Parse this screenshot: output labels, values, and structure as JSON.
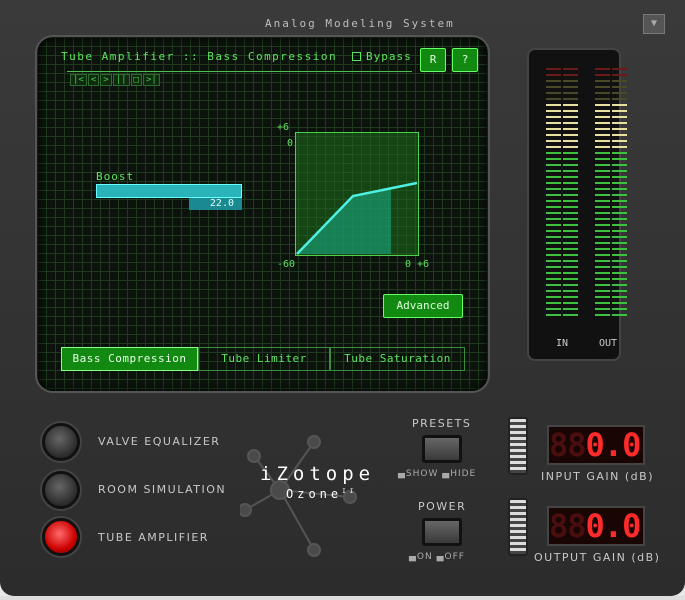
{
  "window": {
    "title": "Analog Modeling System"
  },
  "screen": {
    "header": "Tube Amplifier :: Bass Compression",
    "bypass_label": "Bypass",
    "bypass_checked": false,
    "reset_label": "R",
    "help_label": "?",
    "transport": [
      "|<",
      "<",
      ">",
      "||",
      "□",
      ">|"
    ],
    "boost": {
      "label": "Boost",
      "value": "22.0",
      "level": 1.0
    },
    "compression_graph": {
      "y_top": "+6",
      "y_zero": "0",
      "x_min": "-60",
      "x_max": "0 +6"
    },
    "advanced_label": "Advanced",
    "tabs": [
      {
        "label": "Bass Compression",
        "selected": true
      },
      {
        "label": "Tube Limiter",
        "selected": false
      },
      {
        "label": "Tube Saturation",
        "selected": false
      }
    ]
  },
  "meters": {
    "in_label": "IN",
    "out_label": "OUT"
  },
  "modules": [
    {
      "label": "VALVE EQUALIZER",
      "active": false
    },
    {
      "label": "ROOM SIMULATION",
      "active": false
    },
    {
      "label": "TUBE AMPLIFIER",
      "active": true
    }
  ],
  "logo": {
    "brand": "iZotope",
    "product": "Ozone",
    "version": "II"
  },
  "presets": {
    "label": "PRESETS",
    "show": "SHOW",
    "hide": "HIDE"
  },
  "power": {
    "label": "POWER",
    "on": "ON",
    "off": "OFF"
  },
  "input_gain": {
    "label": "INPUT GAIN (dB)",
    "value": "0.0",
    "dim": "88"
  },
  "output_gain": {
    "label": "OUTPUT GAIN (dB)",
    "value": "0.0",
    "dim": "88"
  },
  "colors": {
    "screen_green": "#5fe35f",
    "accent_cyan": "#2ab3b8",
    "led_red": "#ff2a2a"
  }
}
